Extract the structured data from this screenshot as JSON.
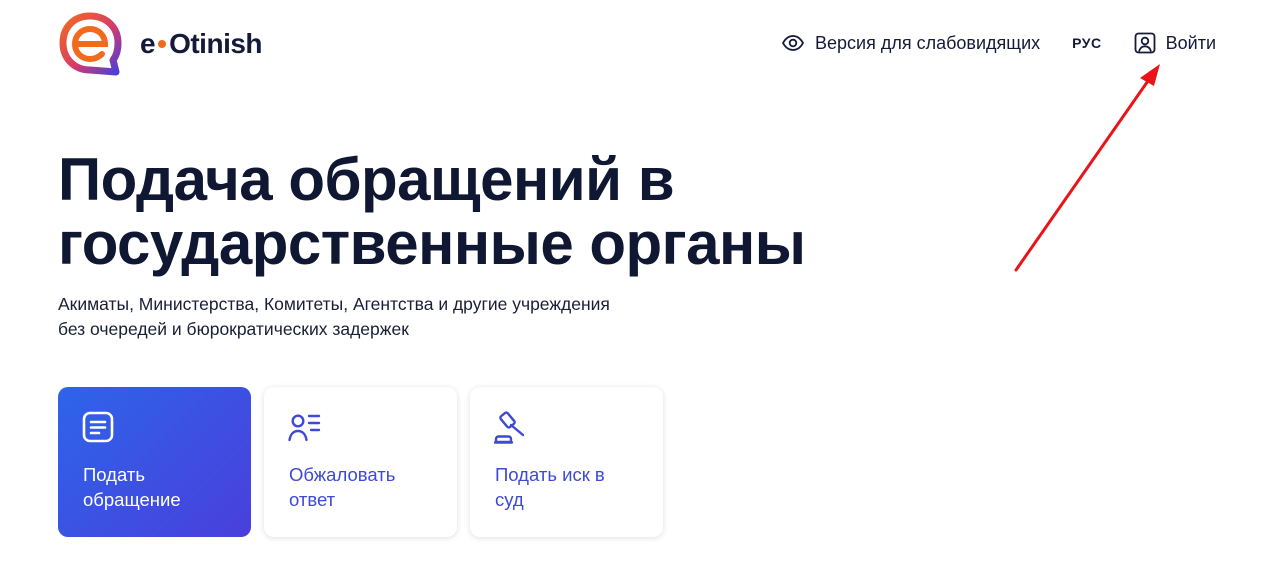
{
  "header": {
    "logo_text_left": "e",
    "logo_text_right": "Otinish",
    "vision_label": "Версия для слабовидящих",
    "lang_label": "РУС",
    "login_label": "Войти"
  },
  "hero": {
    "title_line1": "Подача обращений в",
    "title_line2": "государственные органы",
    "subtitle_line1": "Акиматы, Министерства, Комитеты, Агентства и другие учреждения",
    "subtitle_line2": "без очередей и бюрократических задержек"
  },
  "cards": [
    {
      "line1": "Подать",
      "line2": "обращение",
      "icon": "document-icon"
    },
    {
      "line1": "Обжаловать",
      "line2": "ответ",
      "icon": "user-list-icon"
    },
    {
      "line1": "Подать иск в",
      "line2": "суд",
      "icon": "gavel-icon"
    }
  ],
  "colors": {
    "brand_blue": "#3d4ad6",
    "brand_orange": "#f26b1d",
    "title": "#0f1733",
    "annotation_arrow": "#e8141a"
  }
}
